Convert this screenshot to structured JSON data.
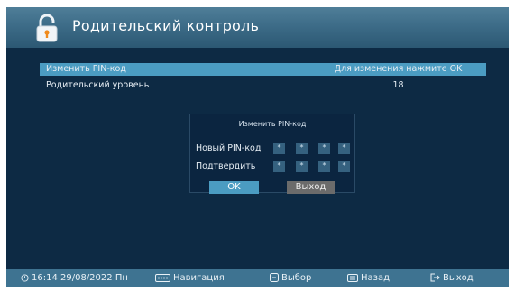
{
  "header": {
    "title": "Родительский контроль",
    "icon": "lock-icon"
  },
  "menu": {
    "items": [
      {
        "label": "Изменить PIN-код",
        "value": "Для изменения нажмите OK",
        "selected": true
      },
      {
        "label": "Родительский уровень",
        "value": "18",
        "selected": false
      }
    ]
  },
  "dialog": {
    "title": "Изменить PIN-код",
    "new_pin_label": "Новый PIN-код",
    "confirm_label": "Подтвердить",
    "new_pin_digits": [
      "*",
      "*",
      "*",
      "*"
    ],
    "confirm_digits": [
      "*",
      "*",
      "*",
      "*"
    ],
    "ok_label": "OK",
    "exit_label": "Выход"
  },
  "footer": {
    "datetime": "16:14 29/08/2022 Пн",
    "nav_label": "Навигация",
    "select_label": "Выбор",
    "back_label": "Назад",
    "exit_label": "Выход"
  },
  "colors": {
    "background": "#0d2a44",
    "accent": "#4b9cc2",
    "footer": "#3e7391"
  }
}
